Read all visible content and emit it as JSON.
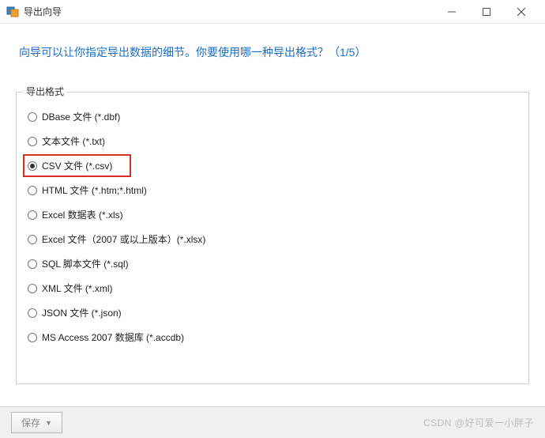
{
  "window": {
    "title": "导出向导"
  },
  "prompt": "向导可以让你指定导出数据的细节。你要使用哪一种导出格式？（1/5）",
  "group": {
    "label": "导出格式",
    "options": [
      {
        "label": "DBase 文件 (*.dbf)",
        "selected": false
      },
      {
        "label": "文本文件 (*.txt)",
        "selected": false
      },
      {
        "label": "CSV 文件 (*.csv)",
        "selected": true
      },
      {
        "label": "HTML 文件 (*.htm;*.html)",
        "selected": false
      },
      {
        "label": "Excel 数据表 (*.xls)",
        "selected": false
      },
      {
        "label": "Excel 文件（2007 或以上版本）(*.xlsx)",
        "selected": false
      },
      {
        "label": "SQL 脚本文件 (*.sql)",
        "selected": false
      },
      {
        "label": "XML 文件 (*.xml)",
        "selected": false
      },
      {
        "label": "JSON 文件 (*.json)",
        "selected": false
      },
      {
        "label": "MS Access 2007 数据库 (*.accdb)",
        "selected": false
      }
    ]
  },
  "footer": {
    "save_label": "保存",
    "watermark": "CSDN @好可爱一小胖子"
  }
}
